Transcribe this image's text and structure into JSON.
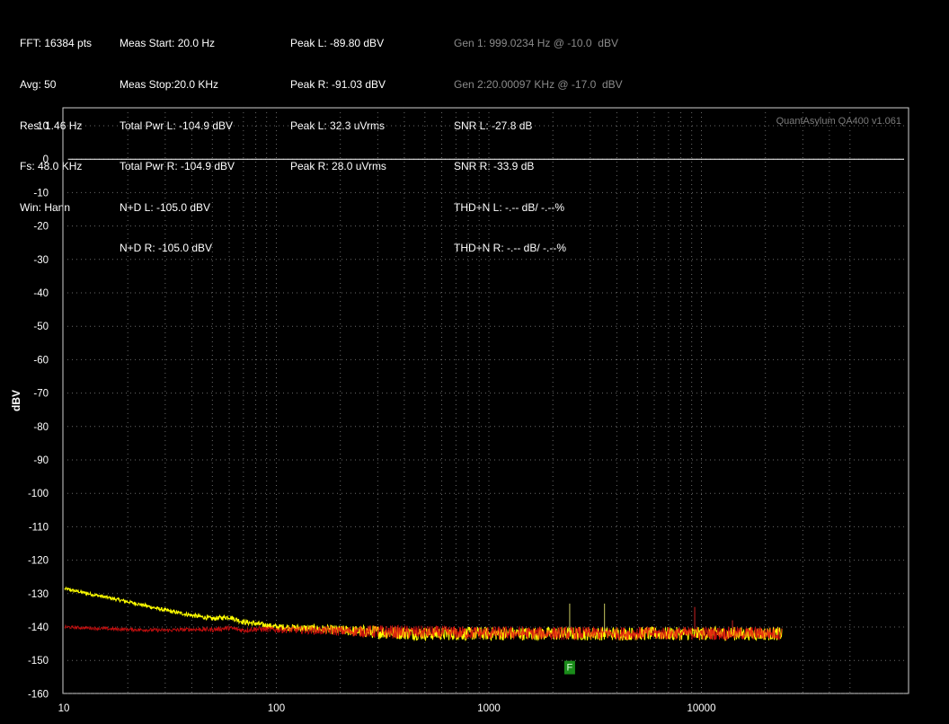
{
  "stats": {
    "col1": [
      "FFT: 16384 pts",
      "Avg: 50",
      "Res: 1.46 Hz",
      "Fs: 48.0 KHz",
      "Win: Hann"
    ],
    "col2": [
      "Meas Start: 20.0 Hz",
      "Meas Stop:20.0 KHz",
      "Total Pwr L: -104.9 dBV",
      "Total Pwr R: -104.9 dBV",
      "N+D L: -105.0 dBV",
      "N+D R: -105.0 dBV"
    ],
    "col3": [
      "Peak L: -89.80 dBV",
      "Peak R: -91.03 dBV",
      "Peak L: 32.3 uVrms",
      "Peak R: 28.0 uVrms"
    ],
    "col4_gen": [
      "Gen 1: 999.0234 Hz @ -10.0  dBV",
      "Gen 2:20.00097 KHz @ -17.0  dBV"
    ],
    "col4": [
      "SNR L: -27.8 dB",
      "SNR R: -33.9 dB",
      "THD+N L: -.-- dB/ -.--%",
      "THD+N R: -.-- dB/ -.--%"
    ]
  },
  "watermark": "QuantAsylum QA400 v1.061",
  "marker_label": "F",
  "chart_data": {
    "type": "line",
    "title": "",
    "xlabel": "",
    "ylabel": "dBV",
    "xscale": "log",
    "xlim": [
      10,
      50000
    ],
    "ylim": [
      -160,
      10
    ],
    "x_ticks": [
      10,
      100,
      1000,
      10000
    ],
    "x_tick_labels": [
      "10",
      "100",
      "1000",
      "10000"
    ],
    "y_ticks": [
      10,
      0,
      -10,
      -20,
      -30,
      -40,
      -50,
      -60,
      -70,
      -80,
      -90,
      -100,
      -110,
      -120,
      -130,
      -140,
      -150,
      -160
    ],
    "y_tick_labels": [
      "10",
      "0",
      "-10",
      "-20",
      "-30",
      "-40",
      "-50",
      "-60",
      "-70",
      "-80",
      "-90",
      "-100",
      "-110",
      "-120",
      "-130",
      "-140",
      "-150",
      "-160"
    ],
    "grid": true,
    "reference_line": {
      "y": 0,
      "x_range": [
        10,
        50000
      ],
      "color": "#ffffff"
    },
    "series": [
      {
        "color": "#ffff00",
        "x": [
          10,
          13,
          17,
          22,
          30,
          40,
          50,
          60,
          70,
          80,
          100,
          150,
          200,
          300,
          500,
          1000,
          2000,
          5000,
          10000,
          15000,
          24000
        ],
        "y": [
          -128.5,
          -130,
          -131.5,
          -133,
          -135,
          -136.5,
          -137.5,
          -137,
          -138.5,
          -139,
          -140,
          -140.5,
          -141,
          -141.5,
          -142,
          -142,
          -142,
          -142,
          -142,
          -142,
          -142
        ]
      },
      {
        "color": "#e01010",
        "x": [
          10,
          13,
          17,
          22,
          30,
          40,
          50,
          60,
          70,
          80,
          100,
          150,
          200,
          300,
          500,
          1000,
          2000,
          5000,
          10000,
          15000,
          24000
        ],
        "y": [
          -140,
          -140.3,
          -140.6,
          -140.8,
          -141,
          -140.7,
          -140.8,
          -140.3,
          -141,
          -140.6,
          -140.8,
          -141,
          -141.2,
          -141.4,
          -141.6,
          -141.8,
          -141.9,
          -141.9,
          -141.9,
          -141.9,
          -141.9
        ]
      }
    ],
    "spurs": [
      {
        "x": 2400,
        "y": -133,
        "color": "#c8c860"
      },
      {
        "x": 3500,
        "y": -133,
        "color": "#c8c860"
      },
      {
        "x": 9300,
        "y": -134,
        "color": "#cc2020"
      },
      {
        "x": 14000,
        "y": -138,
        "color": "#cc2020"
      }
    ],
    "marker": {
      "x": 2400,
      "y": -152,
      "color": "#1a8c1a"
    }
  }
}
